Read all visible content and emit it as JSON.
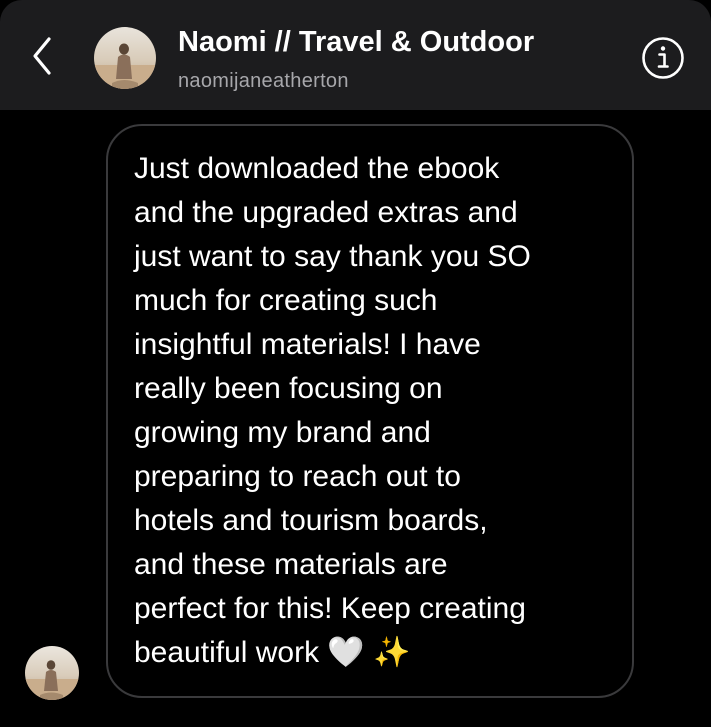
{
  "header": {
    "display_name": "Naomi // Travel & Outdoor",
    "username": "naomijaneatherton",
    "back_icon": "chevron-left-icon",
    "info_icon": "info-icon"
  },
  "message": {
    "text": "Just downloaded the ebook\nand the upgraded extras and\njust want to say thank you SO\nmuch for creating such\ninsightful materials! I have\nreally been focusing on\ngrowing my brand and\npreparing to reach out to\nhotels and tourism boards,\nand these materials are\nperfect for this! Keep creating\nbeautiful work 🤍 ✨"
  },
  "colors": {
    "header_background": "#1c1c1e",
    "page_background": "#000000",
    "bubble_border": "#3a3a3c",
    "secondary_text": "#a7a7ab"
  }
}
